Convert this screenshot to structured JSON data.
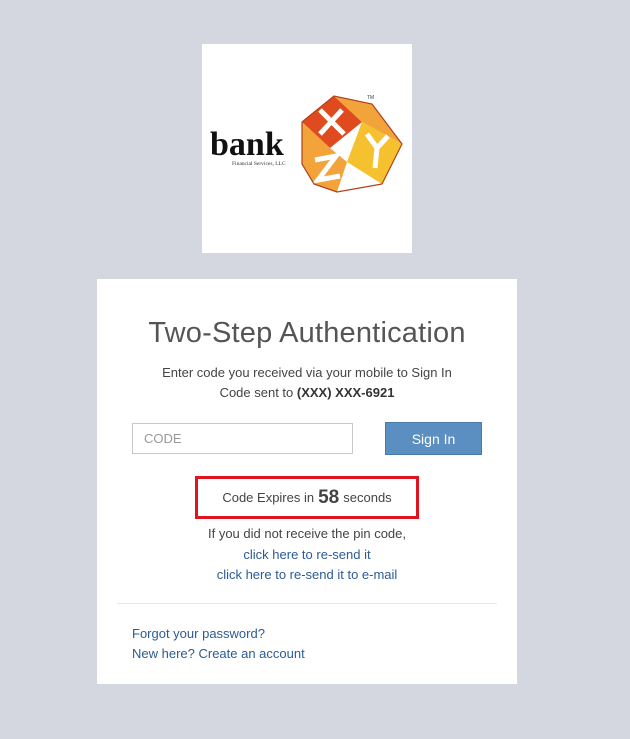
{
  "logo": {
    "name": "bank",
    "subtitle": "Financial Services, LLC",
    "tm": "TM",
    "colors": {
      "red": "#e04a1f",
      "orange": "#f2a33a",
      "yellow": "#f6c12e"
    }
  },
  "card": {
    "title": "Two-Step Authentication",
    "instruction": "Enter code you received via your mobile to Sign In",
    "sent_prefix": "Code sent to ",
    "sent_number": "(XXX) XXX-6921",
    "code_placeholder": "CODE",
    "signin_label": "Sign In",
    "expires_prefix": "Code Expires in",
    "expires_seconds": "58",
    "expires_suffix": "seconds",
    "no_pin_text": "If you did not receive the pin code,",
    "resend_link": "click here to re-send it",
    "resend_email_link": "click here to re-send it to e-mail",
    "forgot_link": "Forgot your password?",
    "create_account_link": "New here? Create an account"
  },
  "colors": {
    "background": "#d4d6e0",
    "button": "#5b8ec1",
    "link": "#2c5b95",
    "highlight_border": "#e0141e"
  }
}
